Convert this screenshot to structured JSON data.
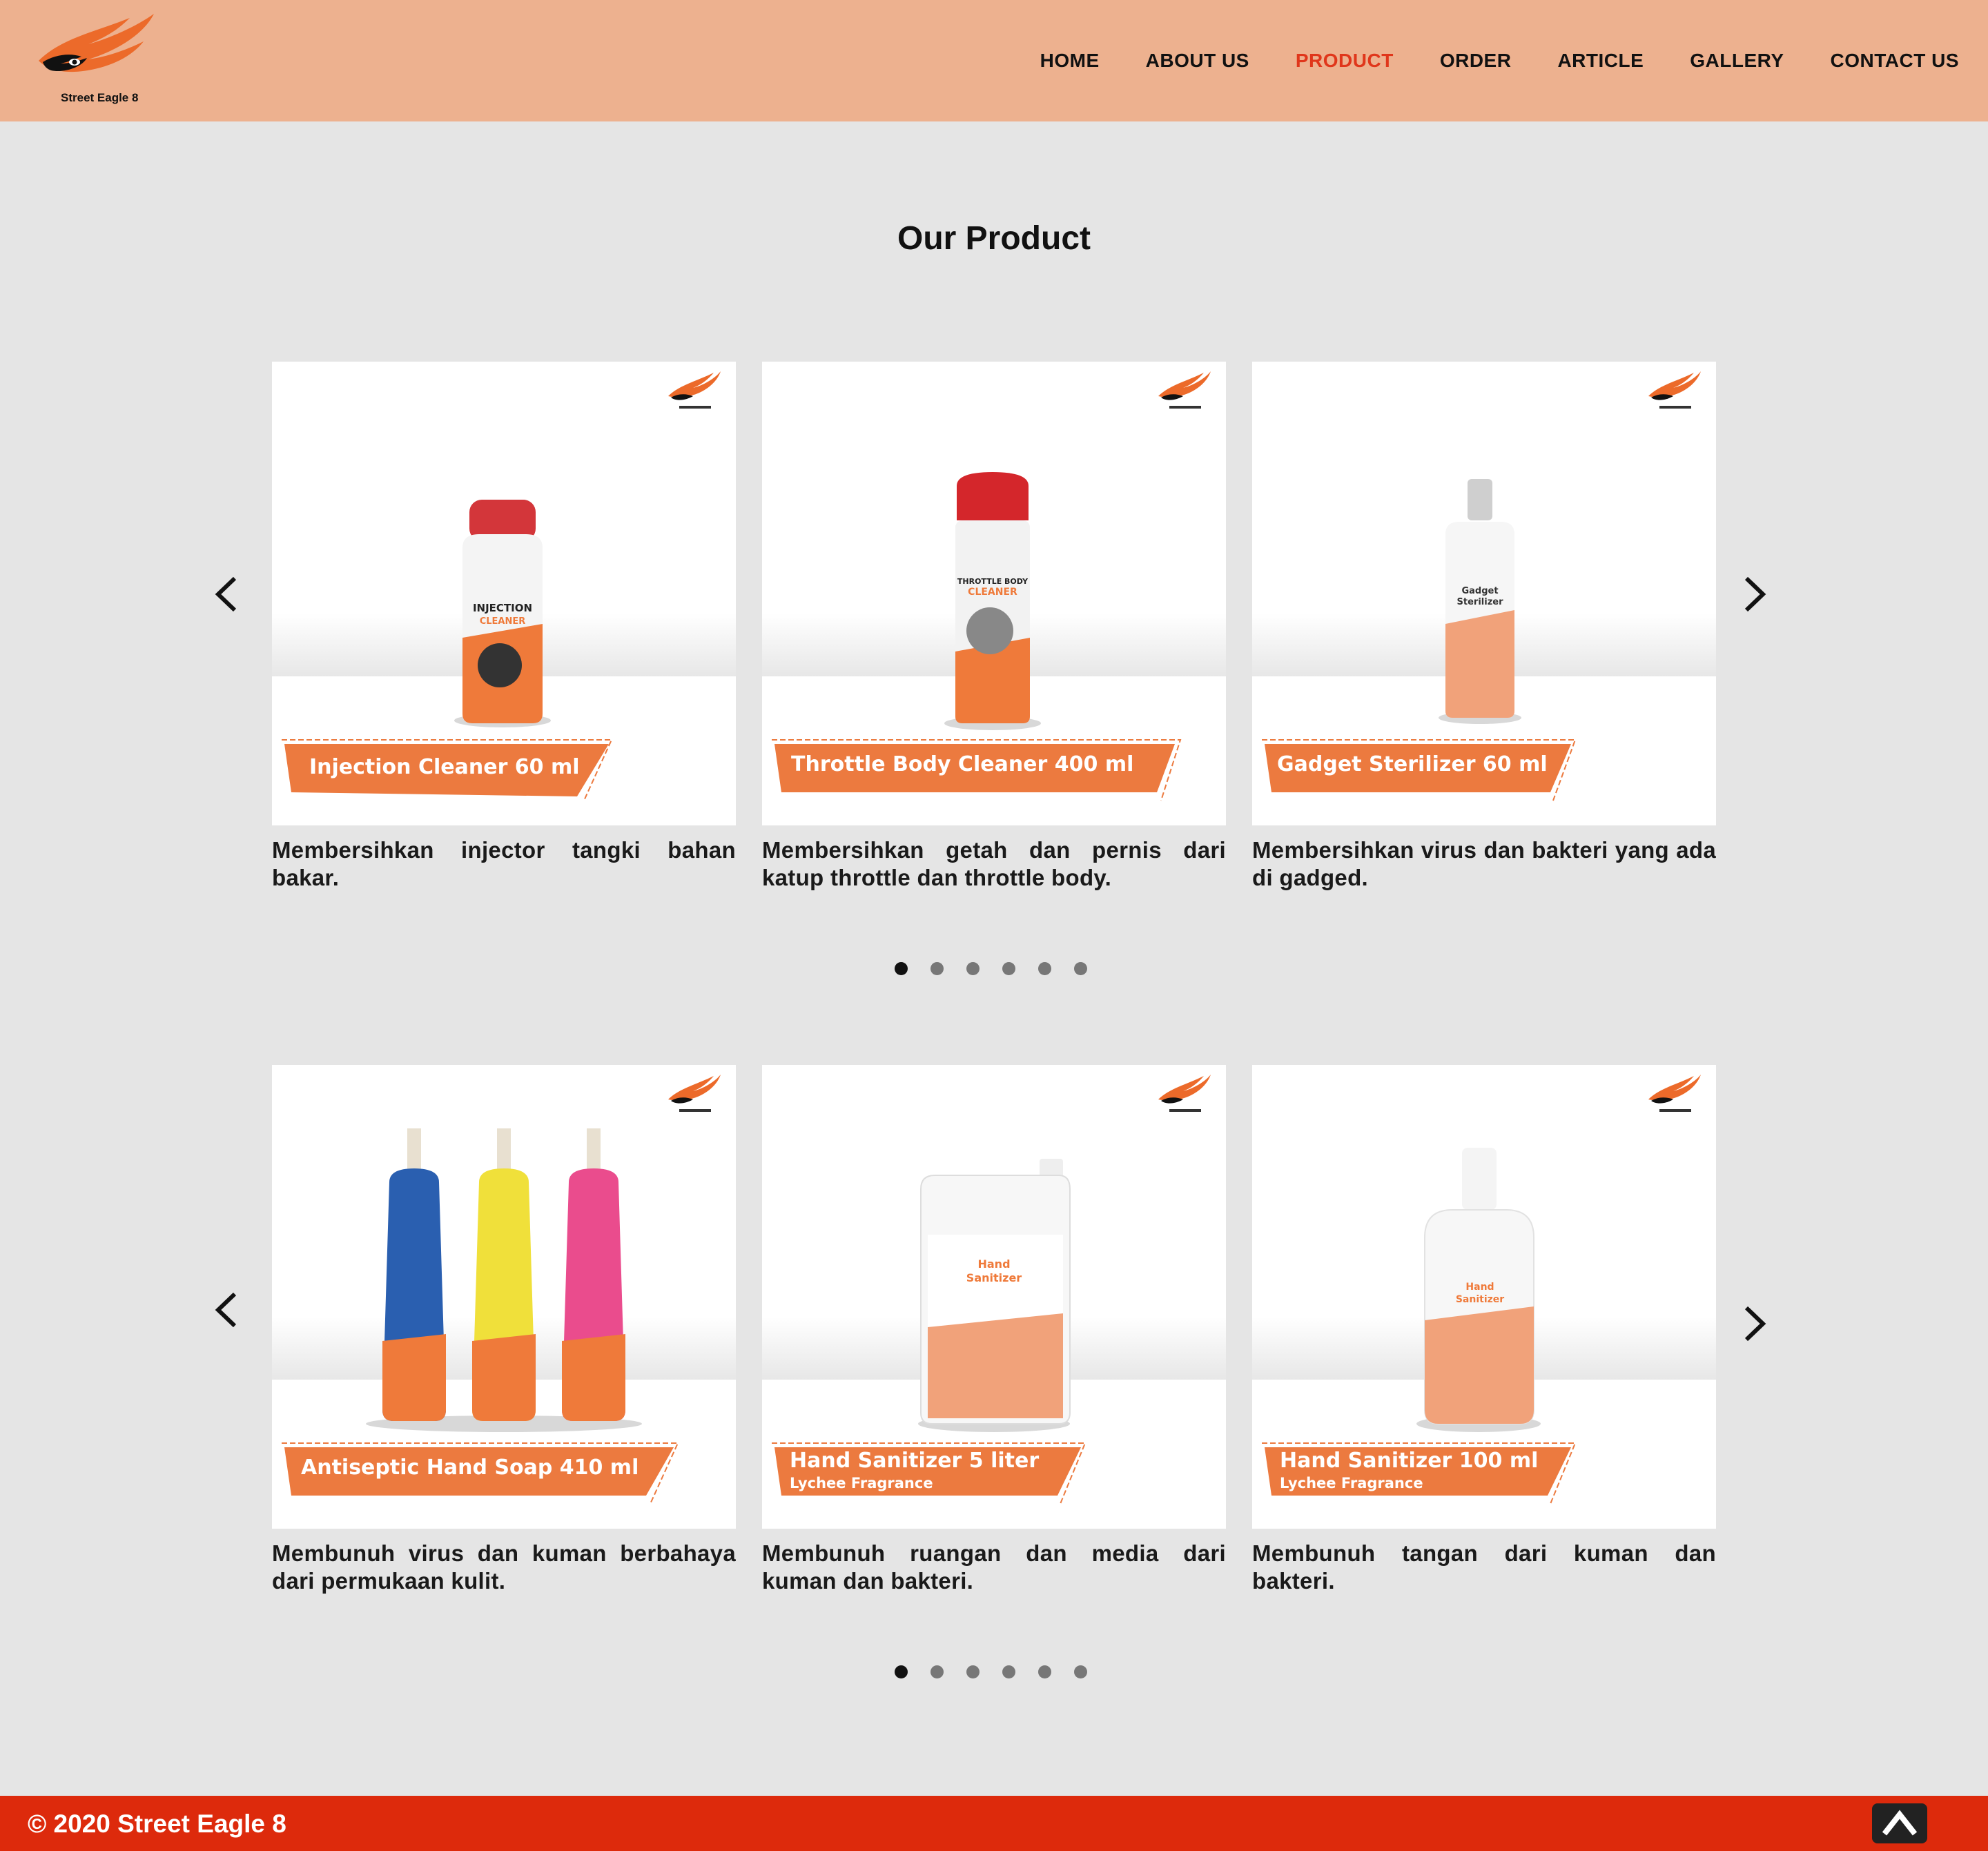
{
  "brand": {
    "name": "Street Eagle 8"
  },
  "nav": {
    "items": [
      {
        "label": "HOME"
      },
      {
        "label": "ABOUT US"
      },
      {
        "label": "PRODUCT"
      },
      {
        "label": "ORDER"
      },
      {
        "label": "ARTICLE"
      },
      {
        "label": "GALLERY"
      },
      {
        "label": "CONTACT US"
      }
    ],
    "active": "PRODUCT",
    "active_color": "#e0361b"
  },
  "page_title": "Our Product",
  "carousels": [
    {
      "active_dot": 1,
      "dot_count": 6,
      "cards": [
        {
          "banner": "Injection Cleaner 60 ml",
          "subtitle": "",
          "description": "Membersihkan injector tangki bahan bakar.",
          "icon": "injection-cleaner-bottle-icon"
        },
        {
          "banner": "Throttle Body Cleaner 400 ml",
          "subtitle": "",
          "description": "Membersihkan getah dan pernis dari katup throttle dan throttle body.",
          "icon": "spray-can-icon"
        },
        {
          "banner": "Gadget Sterilizer 60 ml",
          "subtitle": "",
          "description": "Membersihkan virus dan bakteri yang ada di gadged.",
          "icon": "spray-bottle-icon"
        }
      ]
    },
    {
      "active_dot": 1,
      "dot_count": 6,
      "cards": [
        {
          "banner": "Antiseptic Hand Soap 410 ml",
          "subtitle": "",
          "description": "Membunuh virus dan kuman berbahaya dari permukaan kulit.",
          "icon": "hand-soap-bottles-icon"
        },
        {
          "banner": "Hand Sanitizer 5 liter",
          "subtitle": "Lychee Fragrance",
          "description": "Membunuh ruangan dan media dari kuman dan bakteri.",
          "icon": "jerrycan-icon"
        },
        {
          "banner": "Hand Sanitizer 100 ml",
          "subtitle": "Lychee Fragrance",
          "description": "Membunuh tangan dari kuman dan bakteri.",
          "icon": "sanitizer-bottle-icon"
        }
      ]
    }
  ],
  "footer": {
    "copyright": "© 2020 Street Eagle 8"
  },
  "colors": {
    "header_bg": "#edb18f",
    "footer_bg": "#dd2a0c",
    "banner_orange": "#ec7a3f",
    "page_bg": "#e5e5e5"
  }
}
